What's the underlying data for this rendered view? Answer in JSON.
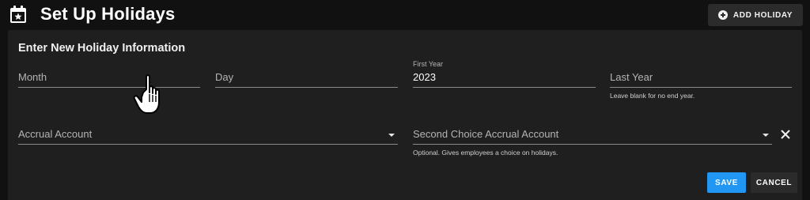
{
  "header": {
    "title": "Set Up Holidays",
    "title_icon": "calendar-star-icon",
    "add_button_label": "ADD HOLIDAY",
    "add_button_icon": "plus-circle-icon"
  },
  "form": {
    "section_title": "Enter New Holiday Information",
    "month": {
      "placeholder": "Month",
      "value": ""
    },
    "day": {
      "placeholder": "Day",
      "value": ""
    },
    "first_year": {
      "label": "First Year",
      "value": "2023"
    },
    "last_year": {
      "placeholder": "Last Year",
      "value": "",
      "hint": "Leave blank for no end year."
    },
    "accrual_account": {
      "placeholder": "Accrual Account",
      "value": ""
    },
    "second_accrual_account": {
      "placeholder": "Second Choice Accrual Account",
      "value": "",
      "hint": "Optional. Gives employees a choice on holidays."
    }
  },
  "actions": {
    "save_label": "SAVE",
    "cancel_label": "CANCEL"
  },
  "colors": {
    "background": "#111111",
    "panel": "#1f1f1f",
    "primary": "#2196f3",
    "secondary_button": "#2b2b2b"
  }
}
